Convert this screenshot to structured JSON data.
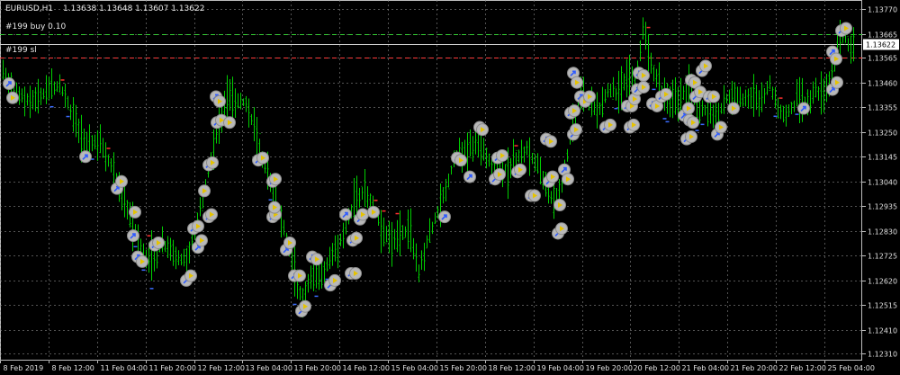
{
  "chart_header": {
    "symbol": "EURUSD,H1",
    "ohlc": "1.13638 1.13648 1.13607 1.13622"
  },
  "order_labels": {
    "buy": "#199 buy 0.10",
    "sl": "#199 sl"
  },
  "colors": {
    "background": "#000000",
    "bars": "#00d000",
    "grid": "#8a8a8a",
    "axis_text": "#e0e0e0",
    "sl_line": "#ff3b3b",
    "buy_line": "#33cc33",
    "price_label_bg": "#ffffff",
    "arrow_up": "#3a6cff",
    "arrow_down": "#ff3030",
    "trade_circle": "#b8b8b8",
    "trade_arrow_blue": "#2f5bff",
    "trade_arrow_yellow": "#e5c300"
  },
  "current_price_label": "1.13622",
  "chart_data": {
    "type": "ohlc-bars",
    "symbol": "EURUSD",
    "timeframe": "H1",
    "y_ticks": [
      "1.13770",
      "1.13665",
      "1.13565",
      "1.13460",
      "1.13355",
      "1.13250",
      "1.13145",
      "1.13040",
      "1.12935",
      "1.12830",
      "1.12725",
      "1.12620",
      "1.12515",
      "1.12410",
      "1.12310"
    ],
    "x_ticks": [
      "8 Feb 2019",
      "8 Feb 12:00",
      "11 Feb 04:00",
      "11 Feb 20:00",
      "12 Feb 12:00",
      "13 Feb 04:00",
      "13 Feb 20:00",
      "14 Feb 12:00",
      "15 Feb 04:00",
      "15 Feb 20:00",
      "18 Feb 12:00",
      "19 Feb 04:00",
      "19 Feb 20:00",
      "20 Feb 12:00",
      "21 Feb 04:00",
      "21 Feb 20:00",
      "22 Feb 12:00",
      "25 Feb 04:00"
    ],
    "ylim": [
      1.1228,
      1.1381
    ],
    "current_price": 1.13622,
    "open_order_price": 1.13665,
    "stop_loss_price": 1.13565,
    "price_path": [
      [
        0,
        1.1352
      ],
      [
        10,
        1.1346
      ],
      [
        20,
        1.134
      ],
      [
        35,
        1.1338
      ],
      [
        50,
        1.1342
      ],
      [
        65,
        1.1345
      ],
      [
        80,
        1.1333
      ],
      [
        95,
        1.1318
      ],
      [
        110,
        1.1321
      ],
      [
        125,
        1.1309
      ],
      [
        140,
        1.1294
      ],
      [
        150,
        1.1282
      ],
      [
        160,
        1.1273
      ],
      [
        170,
        1.1272
      ],
      [
        180,
        1.1277
      ],
      [
        195,
        1.1273
      ],
      [
        205,
        1.127
      ],
      [
        215,
        1.128
      ],
      [
        225,
        1.1297
      ],
      [
        232,
        1.1309
      ],
      [
        240,
        1.1324
      ],
      [
        248,
        1.1336
      ],
      [
        255,
        1.134
      ],
      [
        265,
        1.1338
      ],
      [
        275,
        1.1337
      ],
      [
        285,
        1.1322
      ],
      [
        295,
        1.131
      ],
      [
        305,
        1.1297
      ],
      [
        315,
        1.1283
      ],
      [
        325,
        1.127
      ],
      [
        335,
        1.1254
      ],
      [
        345,
        1.1264
      ],
      [
        355,
        1.1263
      ],
      [
        365,
        1.127
      ],
      [
        375,
        1.1275
      ],
      [
        385,
        1.1288
      ],
      [
        395,
        1.1296
      ],
      [
        405,
        1.1301
      ],
      [
        415,
        1.1292
      ],
      [
        425,
        1.1282
      ],
      [
        435,
        1.1278
      ],
      [
        445,
        1.1282
      ],
      [
        455,
        1.1283
      ],
      [
        465,
        1.1265
      ],
      [
        475,
        1.1279
      ],
      [
        485,
        1.1291
      ],
      [
        495,
        1.13
      ],
      [
        505,
        1.1315
      ],
      [
        515,
        1.1315
      ],
      [
        525,
        1.132
      ],
      [
        535,
        1.132
      ],
      [
        545,
        1.1312
      ],
      [
        555,
        1.1311
      ],
      [
        565,
        1.1308
      ],
      [
        575,
        1.1314
      ],
      [
        585,
        1.1318
      ],
      [
        595,
        1.1311
      ],
      [
        605,
        1.1303
      ],
      [
        615,
        1.1295
      ],
      [
        625,
        1.1303
      ],
      [
        635,
        1.1328
      ],
      [
        645,
        1.134
      ],
      [
        655,
        1.1336
      ],
      [
        665,
        1.1335
      ],
      [
        675,
        1.1342
      ],
      [
        685,
        1.1342
      ],
      [
        695,
        1.1348
      ],
      [
        705,
        1.1346
      ],
      [
        715,
        1.137
      ],
      [
        725,
        1.1352
      ],
      [
        735,
        1.1343
      ],
      [
        745,
        1.1338
      ],
      [
        755,
        1.1338
      ],
      [
        765,
        1.1346
      ],
      [
        775,
        1.1333
      ],
      [
        785,
        1.1335
      ],
      [
        795,
        1.1331
      ],
      [
        805,
        1.1338
      ],
      [
        815,
        1.1341
      ],
      [
        825,
        1.1339
      ],
      [
        835,
        1.1341
      ],
      [
        845,
        1.1339
      ],
      [
        855,
        1.1346
      ],
      [
        865,
        1.1333
      ],
      [
        875,
        1.1332
      ],
      [
        885,
        1.1339
      ],
      [
        895,
        1.1337
      ],
      [
        905,
        1.1342
      ],
      [
        915,
        1.1342
      ],
      [
        925,
        1.135
      ],
      [
        935,
        1.1366
      ],
      [
        945,
        1.13622
      ]
    ],
    "trade_markers": [
      [
        10,
        1.13455,
        "b"
      ],
      [
        14,
        1.13395,
        "y"
      ],
      [
        95,
        1.13145,
        "b"
      ],
      [
        130,
        1.1301,
        "b"
      ],
      [
        135,
        1.1304,
        "y"
      ],
      [
        148,
        1.1281,
        "b"
      ],
      [
        150,
        1.1291,
        "y"
      ],
      [
        153,
        1.1272,
        "b"
      ],
      [
        158,
        1.127,
        "y"
      ],
      [
        172,
        1.1277,
        "b"
      ],
      [
        176,
        1.1278,
        "y"
      ],
      [
        207,
        1.1262,
        "b"
      ],
      [
        212,
        1.1264,
        "y"
      ],
      [
        215,
        1.1284,
        "b"
      ],
      [
        220,
        1.1285,
        "y"
      ],
      [
        220,
        1.1276,
        "b"
      ],
      [
        224,
        1.1279,
        "y"
      ],
      [
        227,
        1.13,
        "y"
      ],
      [
        232,
        1.1289,
        "b"
      ],
      [
        235,
        1.129,
        "y"
      ],
      [
        232,
        1.1311,
        "b"
      ],
      [
        236,
        1.1312,
        "y"
      ],
      [
        240,
        1.134,
        "b"
      ],
      [
        244,
        1.1338,
        "y"
      ],
      [
        241,
        1.1329,
        "b"
      ],
      [
        246,
        1.133,
        "y"
      ],
      [
        255,
        1.1329,
        "y"
      ],
      [
        287,
        1.1313,
        "b"
      ],
      [
        292,
        1.1314,
        "y"
      ],
      [
        303,
        1.1304,
        "b"
      ],
      [
        306,
        1.1305,
        "y"
      ],
      [
        303,
        1.1289,
        "b"
      ],
      [
        306,
        1.129,
        "y"
      ],
      [
        305,
        1.1293,
        "y"
      ],
      [
        318,
        1.1275,
        "b"
      ],
      [
        322,
        1.1278,
        "y"
      ],
      [
        327,
        1.1264,
        "b"
      ],
      [
        333,
        1.1264,
        "y"
      ],
      [
        335,
        1.1249,
        "b"
      ],
      [
        339,
        1.1251,
        "y"
      ],
      [
        347,
        1.1272,
        "b"
      ],
      [
        352,
        1.1271,
        "y"
      ],
      [
        367,
        1.126,
        "b"
      ],
      [
        372,
        1.1262,
        "y"
      ],
      [
        384,
        1.129,
        "b"
      ],
      [
        390,
        1.1265,
        "b"
      ],
      [
        395,
        1.1265,
        "y"
      ],
      [
        392,
        1.1279,
        "b"
      ],
      [
        396,
        1.128,
        "y"
      ],
      [
        400,
        1.1288,
        "b"
      ],
      [
        403,
        1.129,
        "y"
      ],
      [
        415,
        1.1291,
        "y"
      ],
      [
        494,
        1.1289,
        "b"
      ],
      [
        508,
        1.1314,
        "b"
      ],
      [
        512,
        1.1313,
        "y"
      ],
      [
        522,
        1.1306,
        "b"
      ],
      [
        533,
        1.1327,
        "b"
      ],
      [
        536,
        1.1326,
        "y"
      ],
      [
        550,
        1.1305,
        "b"
      ],
      [
        555,
        1.1307,
        "y"
      ],
      [
        553,
        1.1314,
        "b"
      ],
      [
        558,
        1.1315,
        "y"
      ],
      [
        575,
        1.1308,
        "b"
      ],
      [
        578,
        1.1309,
        "y"
      ],
      [
        590,
        1.1298,
        "b"
      ],
      [
        594,
        1.1298,
        "y"
      ],
      [
        607,
        1.1322,
        "b"
      ],
      [
        612,
        1.1321,
        "y"
      ],
      [
        610,
        1.1304,
        "b"
      ],
      [
        614,
        1.1306,
        "y"
      ],
      [
        620,
        1.1282,
        "b"
      ],
      [
        624,
        1.1284,
        "y"
      ],
      [
        622,
        1.1294,
        "y"
      ],
      [
        627,
        1.1309,
        "b"
      ],
      [
        631,
        1.1305,
        "y"
      ],
      [
        634,
        1.1333,
        "b"
      ],
      [
        638,
        1.1334,
        "y"
      ],
      [
        637,
        1.1324,
        "b"
      ],
      [
        640,
        1.1326,
        "y"
      ],
      [
        637,
        1.135,
        "b"
      ],
      [
        641,
        1.1346,
        "y"
      ],
      [
        645,
        1.134,
        "b"
      ],
      [
        650,
        1.1338,
        "y"
      ],
      [
        655,
        1.134,
        "y"
      ],
      [
        673,
        1.1327,
        "b"
      ],
      [
        678,
        1.1328,
        "y"
      ],
      [
        700,
        1.1327,
        "b"
      ],
      [
        704,
        1.1328,
        "y"
      ],
      [
        710,
        1.135,
        "b"
      ],
      [
        715,
        1.1349,
        "y"
      ],
      [
        697,
        1.1336,
        "b"
      ],
      [
        702,
        1.1336,
        "y"
      ],
      [
        705,
        1.1339,
        "y"
      ],
      [
        708,
        1.1343,
        "b"
      ],
      [
        715,
        1.1344,
        "y"
      ],
      [
        725,
        1.1337,
        "b"
      ],
      [
        730,
        1.1336,
        "y"
      ],
      [
        735,
        1.134,
        "b"
      ],
      [
        740,
        1.1341,
        "y"
      ],
      [
        760,
        1.1332,
        "b"
      ],
      [
        765,
        1.1335,
        "y"
      ],
      [
        763,
        1.1322,
        "b"
      ],
      [
        768,
        1.1323,
        "y"
      ],
      [
        766,
        1.133,
        "b"
      ],
      [
        770,
        1.1329,
        "y"
      ],
      [
        768,
        1.1347,
        "b"
      ],
      [
        772,
        1.1346,
        "y"
      ],
      [
        773,
        1.134,
        "b"
      ],
      [
        778,
        1.1342,
        "y"
      ],
      [
        780,
        1.1351,
        "b"
      ],
      [
        784,
        1.1353,
        "y"
      ],
      [
        788,
        1.134,
        "b"
      ],
      [
        793,
        1.134,
        "y"
      ],
      [
        797,
        1.1324,
        "b"
      ],
      [
        801,
        1.1327,
        "y"
      ],
      [
        815,
        1.1335,
        "y"
      ],
      [
        893,
        1.1335,
        "b"
      ],
      [
        925,
        1.1343,
        "b"
      ],
      [
        930,
        1.1346,
        "y"
      ],
      [
        925,
        1.1359,
        "b"
      ],
      [
        929,
        1.1356,
        "y"
      ],
      [
        935,
        1.1368,
        "b"
      ],
      [
        940,
        1.1369,
        "y"
      ]
    ]
  }
}
